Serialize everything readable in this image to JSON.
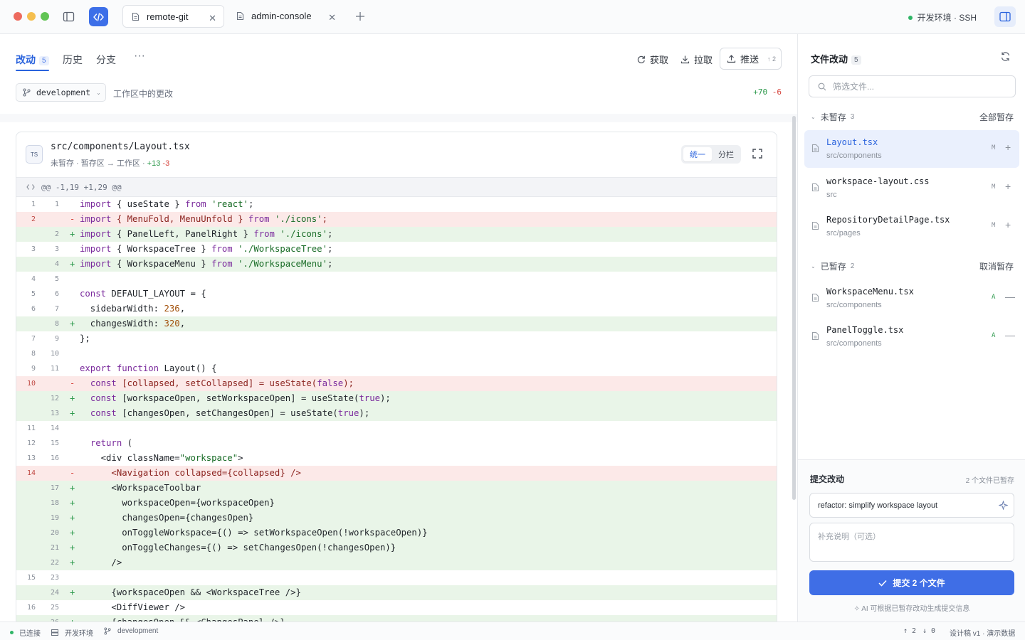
{
  "titlebar": {
    "tabs": [
      {
        "label": "remote-git",
        "active": true
      },
      {
        "label": "admin-console",
        "active": false
      }
    ],
    "environment": "开发环境 · SSH"
  },
  "main": {
    "tabs": [
      {
        "label": "改动",
        "badge": "5"
      },
      {
        "label": "历史"
      },
      {
        "label": "分支"
      }
    ],
    "actions": {
      "fetch": "获取",
      "pull": "拉取",
      "push": "推送",
      "push_count": "↑ 2"
    },
    "branch": "development",
    "worktree_label": "工作区中的更改",
    "additions": "+70",
    "deletions": "-6"
  },
  "file": {
    "badge": "TS",
    "path": "src/components/Layout.tsx",
    "meta": "未暂存 · 暂存区 → 工作区 ·",
    "additions": "+13",
    "deletions": "-3",
    "view_unified": "统一",
    "view_split": "分栏",
    "hunk": "@@ -1,19 +1,29 @@"
  },
  "diff_lines": [
    {
      "o": "1",
      "n": "1",
      "t": "ctx",
      "code": "import { useState } from 'react';"
    },
    {
      "o": "2",
      "n": "",
      "t": "del",
      "code": "import { MenuFold, MenuUnfold } from './icons';"
    },
    {
      "o": "",
      "n": "2",
      "t": "add",
      "code": "import { PanelLeft, PanelRight } from './icons';"
    },
    {
      "o": "3",
      "n": "3",
      "t": "ctx",
      "code": "import { WorkspaceTree } from './WorkspaceTree';"
    },
    {
      "o": "",
      "n": "4",
      "t": "add",
      "code": "import { WorkspaceMenu } from './WorkspaceMenu';"
    },
    {
      "o": "4",
      "n": "5",
      "t": "ctx",
      "code": ""
    },
    {
      "o": "5",
      "n": "6",
      "t": "ctx",
      "code": "const DEFAULT_LAYOUT = {"
    },
    {
      "o": "6",
      "n": "7",
      "t": "ctx",
      "code": "  sidebarWidth: 236,"
    },
    {
      "o": "",
      "n": "8",
      "t": "add",
      "code": "  changesWidth: 320,"
    },
    {
      "o": "7",
      "n": "9",
      "t": "ctx",
      "code": "};"
    },
    {
      "o": "8",
      "n": "10",
      "t": "ctx",
      "code": ""
    },
    {
      "o": "9",
      "n": "11",
      "t": "ctx",
      "code": "export function Layout() {"
    },
    {
      "o": "10",
      "n": "",
      "t": "del",
      "code": "  const [collapsed, setCollapsed] = useState(false);"
    },
    {
      "o": "",
      "n": "12",
      "t": "add",
      "code": "  const [workspaceOpen, setWorkspaceOpen] = useState(true);"
    },
    {
      "o": "",
      "n": "13",
      "t": "add",
      "code": "  const [changesOpen, setChangesOpen] = useState(true);"
    },
    {
      "o": "11",
      "n": "14",
      "t": "ctx",
      "code": ""
    },
    {
      "o": "12",
      "n": "15",
      "t": "ctx",
      "code": "  return ("
    },
    {
      "o": "13",
      "n": "16",
      "t": "ctx",
      "code": "    <div className=\"workspace\">"
    },
    {
      "o": "14",
      "n": "",
      "t": "del",
      "code": "      <Navigation collapsed={collapsed} />"
    },
    {
      "o": "",
      "n": "17",
      "t": "add",
      "code": "      <WorkspaceToolbar"
    },
    {
      "o": "",
      "n": "18",
      "t": "add",
      "code": "        workspaceOpen={workspaceOpen}"
    },
    {
      "o": "",
      "n": "19",
      "t": "add",
      "code": "        changesOpen={changesOpen}"
    },
    {
      "o": "",
      "n": "20",
      "t": "add",
      "code": "        onToggleWorkspace={() => setWorkspaceOpen(!workspaceOpen)}"
    },
    {
      "o": "",
      "n": "21",
      "t": "add",
      "code": "        onToggleChanges={() => setChangesOpen(!changesOpen)}"
    },
    {
      "o": "",
      "n": "22",
      "t": "add",
      "code": "      />"
    },
    {
      "o": "15",
      "n": "23",
      "t": "ctx",
      "code": ""
    },
    {
      "o": "",
      "n": "24",
      "t": "add",
      "code": "      {workspaceOpen && <WorkspaceTree />}"
    },
    {
      "o": "16",
      "n": "25",
      "t": "ctx",
      "code": "      <DiffViewer />"
    },
    {
      "o": "",
      "n": "26",
      "t": "add",
      "code": "      {changesOpen && <ChangesPanel />}"
    }
  ],
  "sidebar": {
    "title": "文件改动",
    "count": "5",
    "filter_placeholder": "筛选文件...",
    "unstaged": {
      "label": "未暂存",
      "count": "3",
      "action": "全部暂存",
      "files": [
        {
          "name": "Layout.tsx",
          "dir": "src/components",
          "status": "M",
          "selected": true
        },
        {
          "name": "workspace-layout.css",
          "dir": "src",
          "status": "M"
        },
        {
          "name": "RepositoryDetailPage.tsx",
          "dir": "src/pages",
          "status": "M"
        }
      ]
    },
    "staged": {
      "label": "已暂存",
      "count": "2",
      "action": "取消暂存",
      "files": [
        {
          "name": "WorkspaceMenu.tsx",
          "dir": "src/components",
          "status": "A"
        },
        {
          "name": "PanelToggle.tsx",
          "dir": "src/components",
          "status": "A"
        }
      ]
    },
    "commit": {
      "title": "提交改动",
      "staged_info": "2 个文件已暂存",
      "message": "refactor: simplify workspace layout",
      "description_placeholder": "补充说明（可选）",
      "button": "提交 2 个文件",
      "hint": "AI 可根据已暂存改动生成提交信息"
    }
  },
  "statusbar": {
    "connected": "已连接",
    "environment": "开发环境",
    "branch": "development",
    "ahead": "↑ 2",
    "behind": "↓ 0",
    "version": "设计稿 v1 · 演示数据"
  },
  "colors": {
    "accent": "#3d6fe8",
    "added_bg": "#e9f5e8",
    "deleted_bg": "#fce9e8",
    "connected": "#2fb566"
  }
}
